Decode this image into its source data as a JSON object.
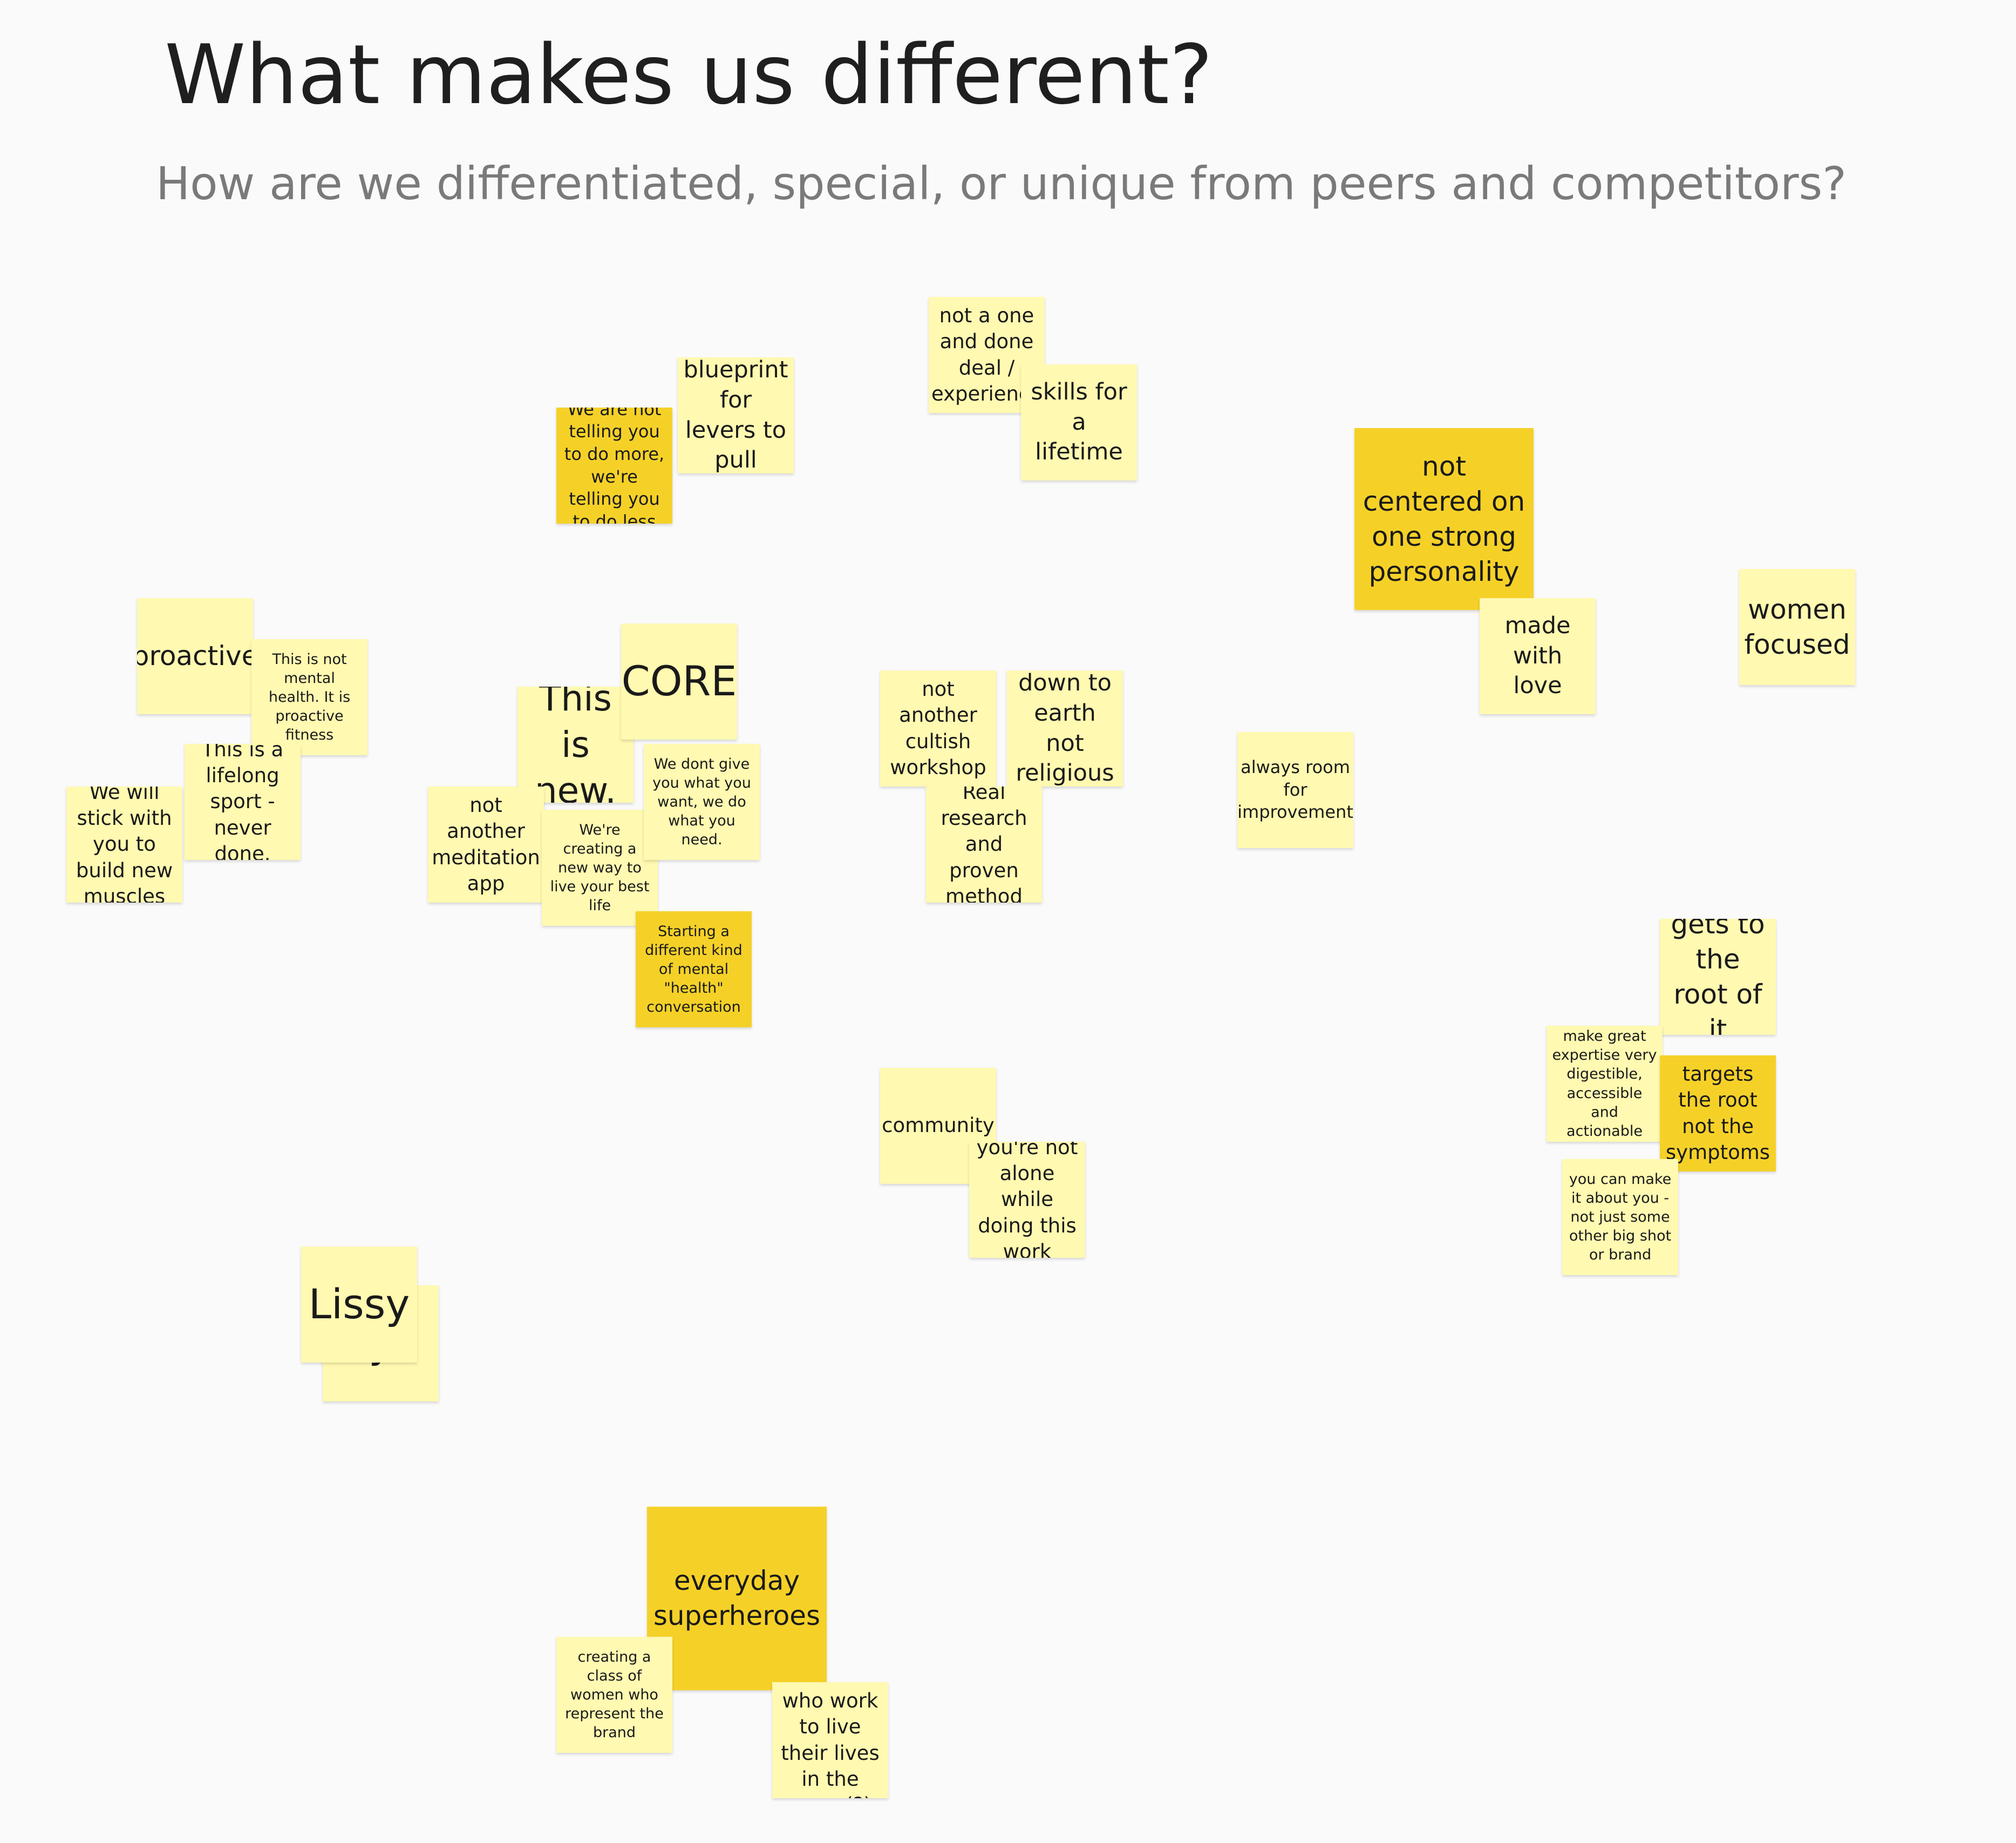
{
  "board": {
    "title": "What makes us different?",
    "subtitle": "How are we differentiated, special, or unique from peers and competitors?"
  },
  "notes": {
    "proactive": "proactive",
    "not_mental_health": "This is not mental health. It is proactive fitness",
    "lifelong_sport": "This is a lifelong sport - never done.",
    "stick_with_you": "We will stick with you to build new muscles",
    "not_telling_more": "We are not telling you to do more, we're telling you to do less",
    "blueprint": "blueprint for levers to pull",
    "this_is_new": "This is new.",
    "core": "CORE",
    "not_meditation": "not another meditation app",
    "creating_new_way": "We're creating a new way to live your best life",
    "dont_give": "We dont give you what you want, we do what you need.",
    "mental_health_conversation": "Starting a different kind of mental \"health\" conversation",
    "not_one_and_done": "not a one and done deal / experience",
    "skills_lifetime": "skills for a lifetime",
    "not_cultish": "not another cultish workshop",
    "down_to_earth": "down to earth not religious",
    "real_research": "Real research and proven method",
    "community": "community",
    "not_alone": "you're not alone while doing this work",
    "not_centered": "not centered on one strong personality",
    "made_with_love": "made with love",
    "women_focused": "women focused",
    "room_improvement": "always room for improvement",
    "root_of_it": "gets to the root of it",
    "great_expertise": "make great expertise very digestible, accessible and actionable",
    "targets_root": "targets the root not the symptoms",
    "about_you": "you can make it about you - not just some other big shot or brand",
    "lissy": "Lissy",
    "lissy_hidden": "y",
    "superheroes": "everyday superheroes",
    "class_of_women": "creating a class of women who represent the brand",
    "women_work_live": "women who work to live their lives in the open (?)"
  },
  "colors": {
    "light_note": "#fff9b1",
    "dark_note": "#f5d128",
    "canvas": "#fafafa"
  }
}
